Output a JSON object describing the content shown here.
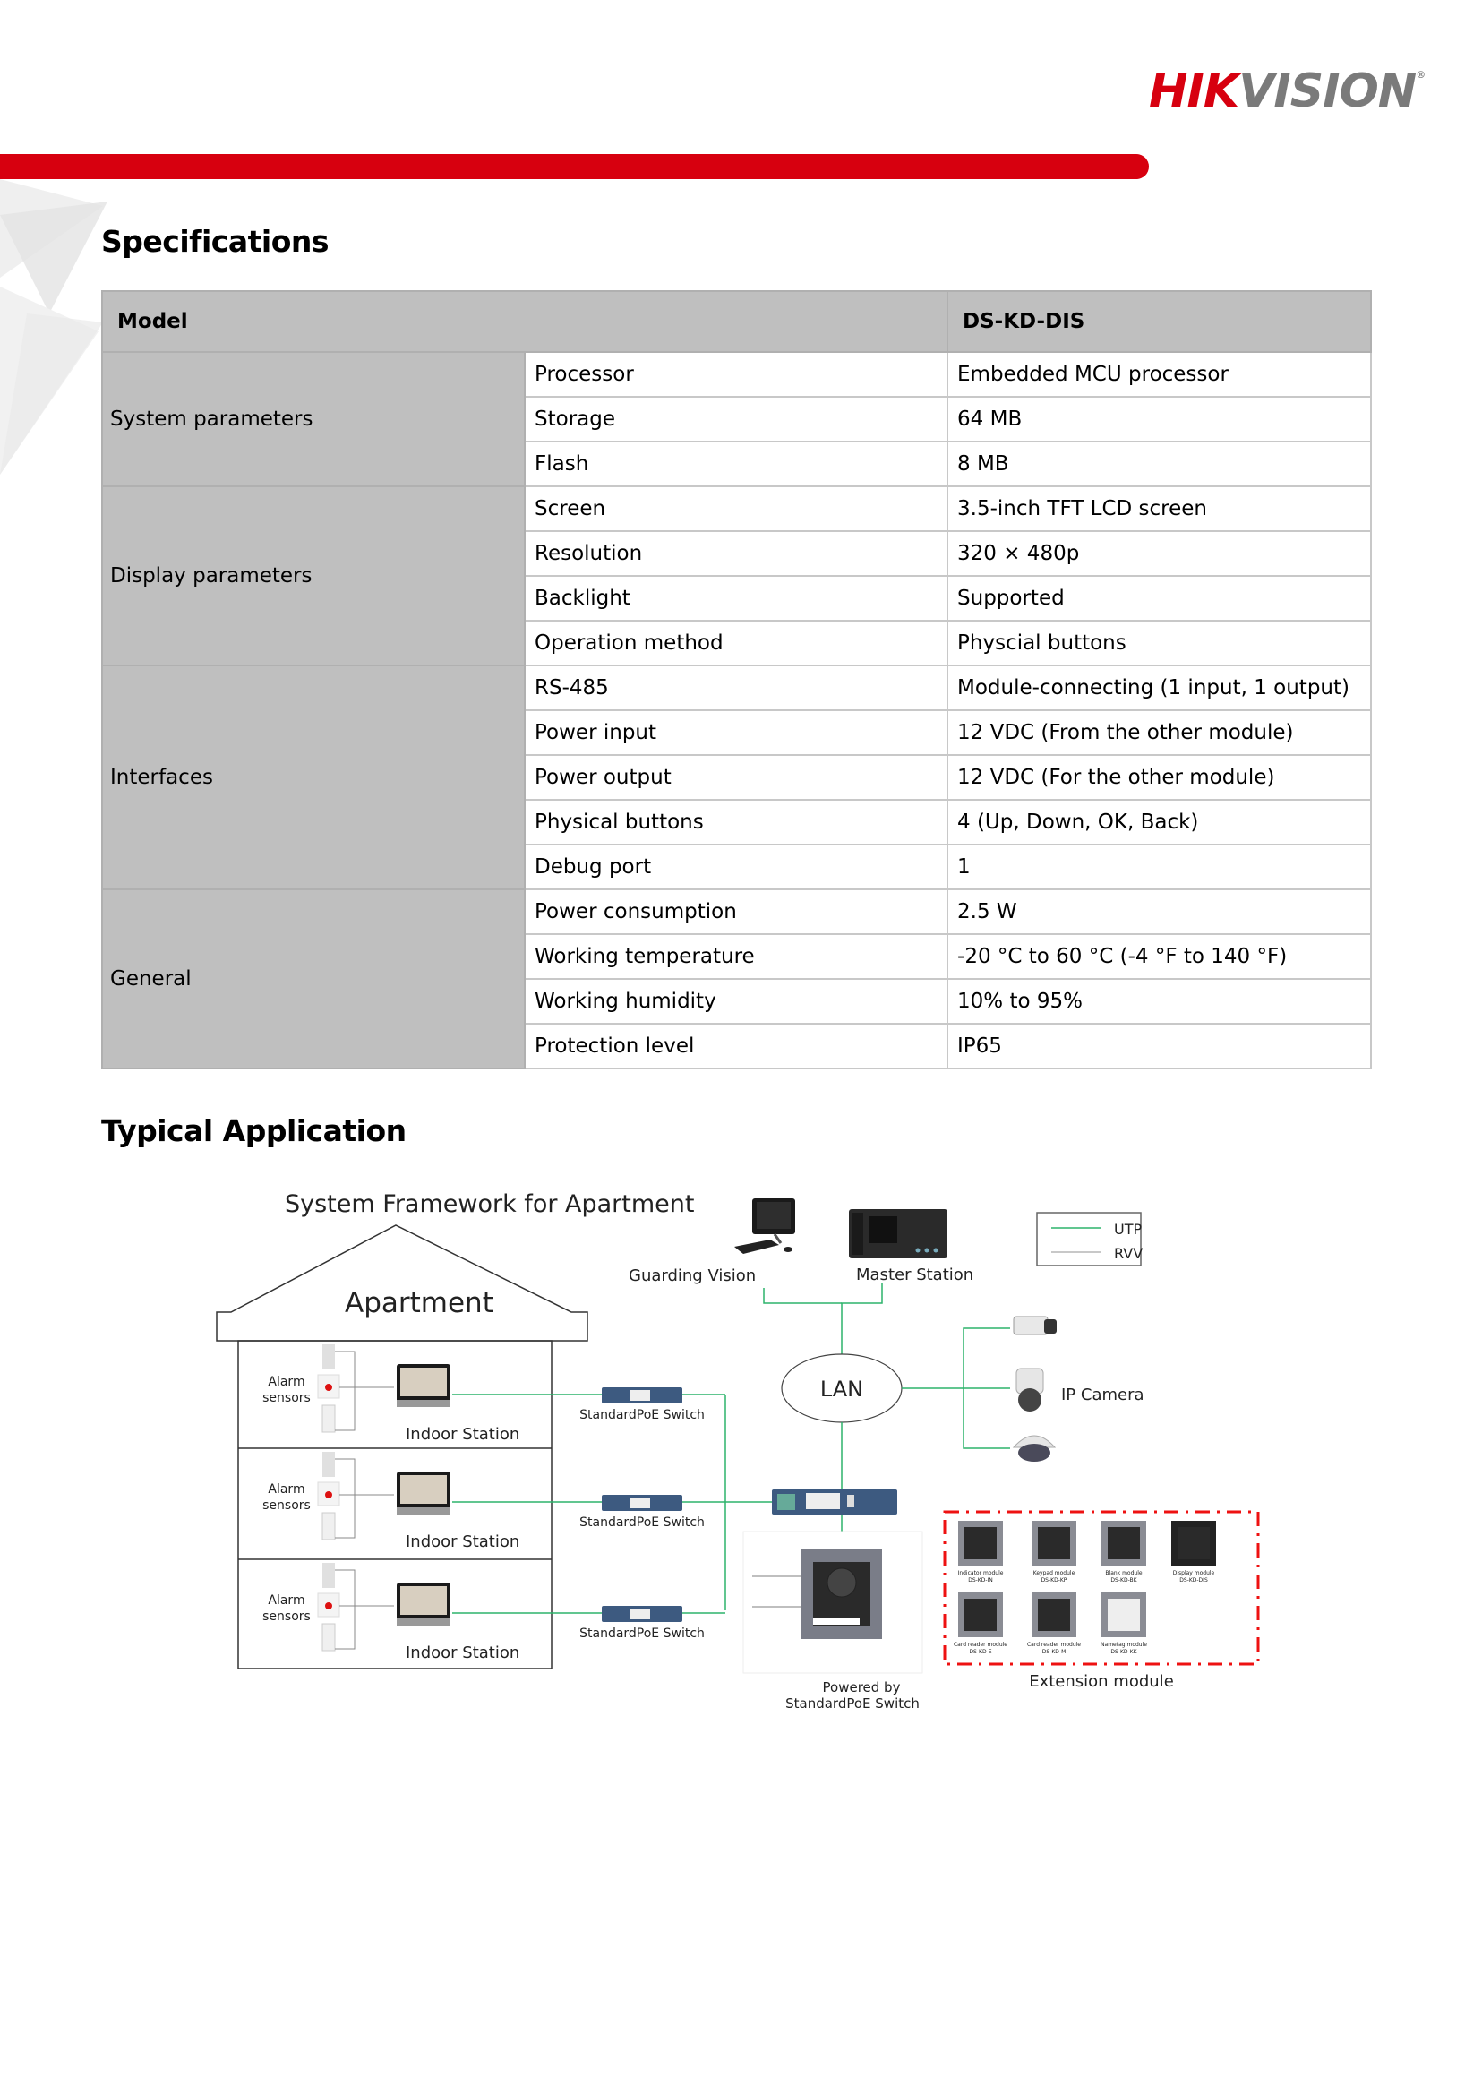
{
  "brand": {
    "logo_primary": "HIK",
    "logo_secondary": "VISION",
    "registered_mark": "®",
    "colors": {
      "red": "#d7000f",
      "gray": "#7a7a7a",
      "utp_green": "#2db36b",
      "header_gray": "#bfbfbf"
    }
  },
  "specifications": {
    "title": "Specifications",
    "header": {
      "label": "Model",
      "model": "DS-KD-DIS"
    },
    "groups": [
      {
        "name": "System parameters",
        "rows": [
          {
            "param": "Processor",
            "value": "Embedded MCU processor"
          },
          {
            "param": "Storage",
            "value": "64 MB"
          },
          {
            "param": "Flash",
            "value": "8 MB"
          }
        ]
      },
      {
        "name": "Display parameters",
        "rows": [
          {
            "param": "Screen",
            "value": "3.5-inch TFT LCD screen"
          },
          {
            "param": "Resolution",
            "value": "320 × 480p"
          },
          {
            "param": "Backlight",
            "value": "Supported"
          },
          {
            "param": "Operation method",
            "value": "Physcial buttons"
          }
        ]
      },
      {
        "name": "Interfaces",
        "rows": [
          {
            "param": "RS-485",
            "value": "Module-connecting (1 input, 1 output)"
          },
          {
            "param": "Power input",
            "value": "12 VDC (From the other module)"
          },
          {
            "param": "Power output",
            "value": "12 VDC (For the other module)"
          },
          {
            "param": "Physical buttons",
            "value": "4 (Up, Down, OK, Back)"
          },
          {
            "param": "Debug port",
            "value": "1"
          }
        ]
      },
      {
        "name": "General",
        "rows": [
          {
            "param": "Power consumption",
            "value": "2.5 W"
          },
          {
            "param": "Working temperature",
            "value": "-20 °C to 60 °C (-4 °F to 140 °F)"
          },
          {
            "param": "Working humidity",
            "value": "10% to 95%"
          },
          {
            "param": "Protection level",
            "value": "IP65"
          }
        ]
      }
    ]
  },
  "typical_application": {
    "title": "Typical Application",
    "diagram": {
      "title": "System Framework for Apartment",
      "apartment_label": "Apartment",
      "floors": [
        {
          "sensors_label": "Alarm sensors",
          "station_label": "Indoor Station",
          "switch_label": "StandardPoE Switch"
        },
        {
          "sensors_label": "Alarm sensors",
          "station_label": "Indoor Station",
          "switch_label": "StandardPoE Switch"
        },
        {
          "sensors_label": "Alarm sensors",
          "station_label": "Indoor Station",
          "switch_label": "StandardPoE Switch"
        }
      ],
      "guarding_vision_label": "Guarding Vision",
      "master_station_label": "Master Station",
      "lan_label": "LAN",
      "ip_camera_label": "IP Camera",
      "legend": [
        {
          "label": "UTP",
          "color": "#2db36b"
        },
        {
          "label": "RVV",
          "color": "#b5b5b5"
        }
      ],
      "door_station_label_line1": "Powered by",
      "door_station_label_line2": "StandardPoE Switch",
      "extension_module_label": "Extension module",
      "extension_modules": [
        {
          "name": "Indicator module",
          "model": "DS-KD-IN"
        },
        {
          "name": "Keypad module",
          "model": "DS-KD-KP"
        },
        {
          "name": "Blank module",
          "model": "DS-KD-BK"
        },
        {
          "name": "Display module",
          "model": "DS-KD-DIS"
        },
        {
          "name": "Card reader module",
          "model": "DS-KD-E"
        },
        {
          "name": "Card reader module",
          "model": "DS-KD-M"
        },
        {
          "name": "Nametag module",
          "model": "DS-KD-KK"
        }
      ]
    }
  }
}
